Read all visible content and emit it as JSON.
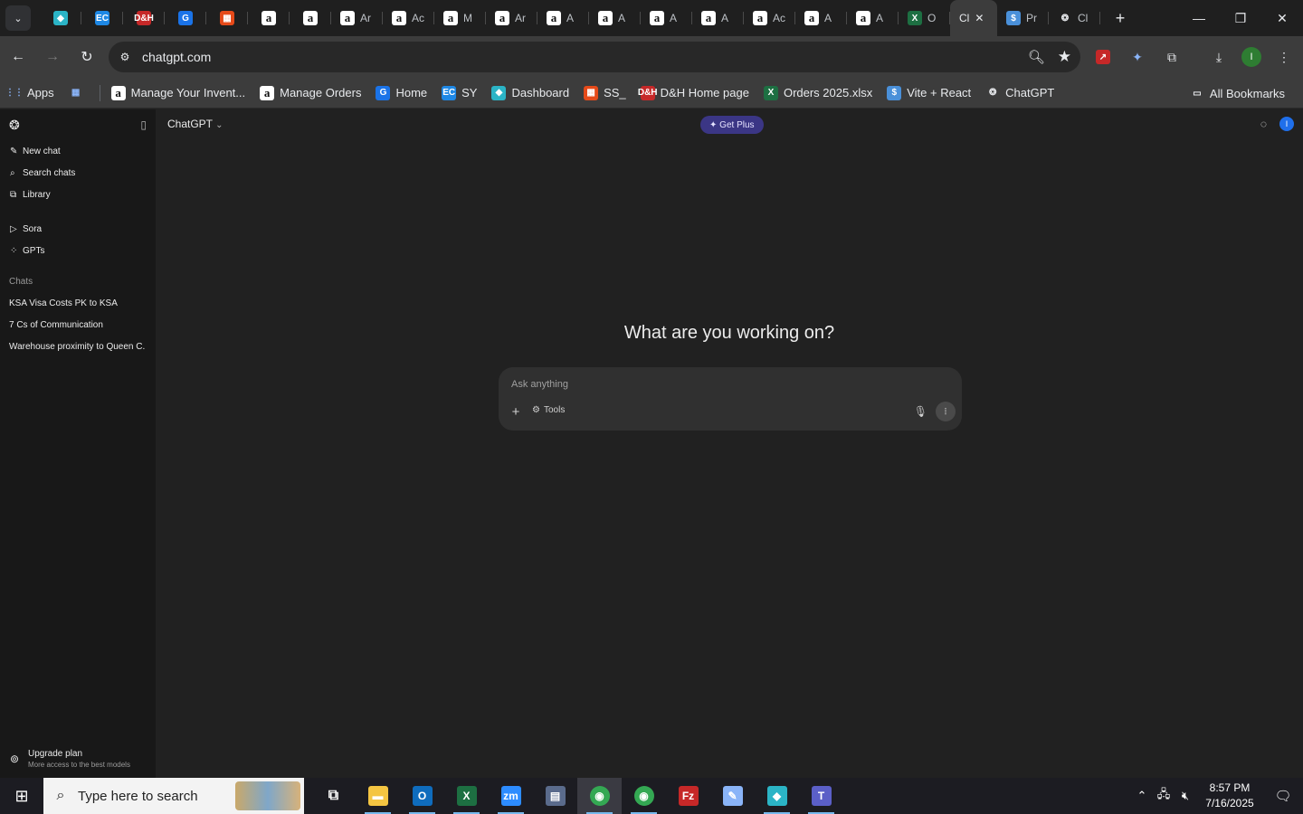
{
  "browser": {
    "tabs": [
      {
        "icon": "diamond-icon",
        "label": "",
        "color": "#2bb4c6"
      },
      {
        "icon": "ec-icon",
        "label": "",
        "color": "#1e88e5"
      },
      {
        "icon": "dh-icon",
        "label": "",
        "color": "#c62828"
      },
      {
        "icon": "docs-icon",
        "label": "",
        "color": "#1a73e8"
      },
      {
        "icon": "box-icon",
        "label": "",
        "color": "#e64a19"
      },
      {
        "icon": "amazon-icon",
        "label": ""
      },
      {
        "icon": "amazon-icon",
        "label": ""
      },
      {
        "icon": "amazon-icon",
        "label": "Ar"
      },
      {
        "icon": "amazon-icon",
        "label": "Ac"
      },
      {
        "icon": "amazon-icon",
        "label": "M"
      },
      {
        "icon": "amazon-icon",
        "label": "Ar"
      },
      {
        "icon": "amazon-icon",
        "label": "A"
      },
      {
        "icon": "amazon-icon",
        "label": "A"
      },
      {
        "icon": "amazon-icon",
        "label": "A"
      },
      {
        "icon": "amazon-icon",
        "label": "A"
      },
      {
        "icon": "amazon-icon",
        "label": "Ac"
      },
      {
        "icon": "amazon-icon",
        "label": "A"
      },
      {
        "icon": "amazon-icon",
        "label": "A"
      },
      {
        "icon": "excel-icon",
        "label": "O",
        "color": "#1d6f42"
      }
    ],
    "active_tab": {
      "label": "Cl",
      "close": "✕"
    },
    "after_tabs": [
      {
        "icon": "dollar-icon",
        "label": "Pr",
        "color": "#4a90d9"
      },
      {
        "icon": "openai-icon",
        "label": "Cl"
      }
    ],
    "url": "chatgpt.com",
    "bookmarks": [
      {
        "label": "Apps",
        "icon": "apps-grid-icon"
      },
      {
        "label": "",
        "icon": "tab-groups-icon"
      },
      {
        "label": "Manage Your Invent...",
        "icon": "amazon-icon"
      },
      {
        "label": "Manage Orders",
        "icon": "amazon-icon"
      },
      {
        "label": "Home",
        "icon": "docs-icon",
        "color": "#1a73e8"
      },
      {
        "label": "SY",
        "icon": "ec-icon",
        "color": "#1e88e5"
      },
      {
        "label": "Dashboard",
        "icon": "diamond-icon",
        "color": "#2bb4c6"
      },
      {
        "label": "SS_",
        "icon": "box-icon",
        "color": "#e64a19"
      },
      {
        "label": "D&H Home page",
        "icon": "dh-icon",
        "color": "#c62828"
      },
      {
        "label": "Orders 2025.xlsx",
        "icon": "excel-icon",
        "color": "#1d6f42"
      },
      {
        "label": "Vite + React",
        "icon": "dollar-icon",
        "color": "#4a90d9"
      },
      {
        "label": "ChatGPT",
        "icon": "openai-icon"
      }
    ],
    "all_bookmarks": "All Bookmarks",
    "profile_initial": "I"
  },
  "sidebar": {
    "items": [
      {
        "label": "New chat",
        "icon": "compose-icon"
      },
      {
        "label": "Search chats",
        "icon": "search-icon"
      },
      {
        "label": "Library",
        "icon": "library-icon"
      }
    ],
    "items2": [
      {
        "label": "Sora",
        "icon": "play-circle-icon"
      },
      {
        "label": "GPTs",
        "icon": "grid-icon"
      }
    ],
    "section_title": "Chats",
    "chats": [
      "KSA Visa Costs PK to KSA",
      "7 Cs of Communication",
      "Warehouse proximity to Queen C..."
    ],
    "upgrade": {
      "title": "Upgrade plan",
      "subtitle": "More access to the best models"
    }
  },
  "main": {
    "model": "ChatGPT",
    "get_plus": "Get Plus",
    "hero": "What are you working on?",
    "placeholder": "Ask anything",
    "tools": "Tools",
    "avatar": "I"
  },
  "taskbar": {
    "search_placeholder": "Type here to search",
    "time": "8:57 PM",
    "date": "7/16/2025",
    "apps": [
      {
        "icon": "task-view-icon",
        "running": false
      },
      {
        "icon": "file-explorer-icon",
        "running": true,
        "color": "#f4c542"
      },
      {
        "icon": "outlook-icon",
        "running": true,
        "color": "#0f6cbd"
      },
      {
        "icon": "excel-icon",
        "running": true,
        "color": "#1d6f42"
      },
      {
        "icon": "zoom-icon",
        "running": true,
        "color": "#2d8cff"
      },
      {
        "icon": "calculator-icon",
        "running": false,
        "color": "#5a6b8c"
      },
      {
        "icon": "chrome-icon",
        "running": true,
        "active": true,
        "color": "#34a853"
      },
      {
        "icon": "chrome-profile-icon",
        "running": true,
        "color": "#34a853"
      },
      {
        "icon": "filezilla-icon",
        "running": false,
        "color": "#c62828"
      },
      {
        "icon": "notepad-icon",
        "running": false,
        "color": "#8ab4f8"
      },
      {
        "icon": "diamond-app-icon",
        "running": true,
        "color": "#2bb4c6"
      },
      {
        "icon": "teams-icon",
        "running": true,
        "color": "#5b5fc7"
      }
    ]
  }
}
